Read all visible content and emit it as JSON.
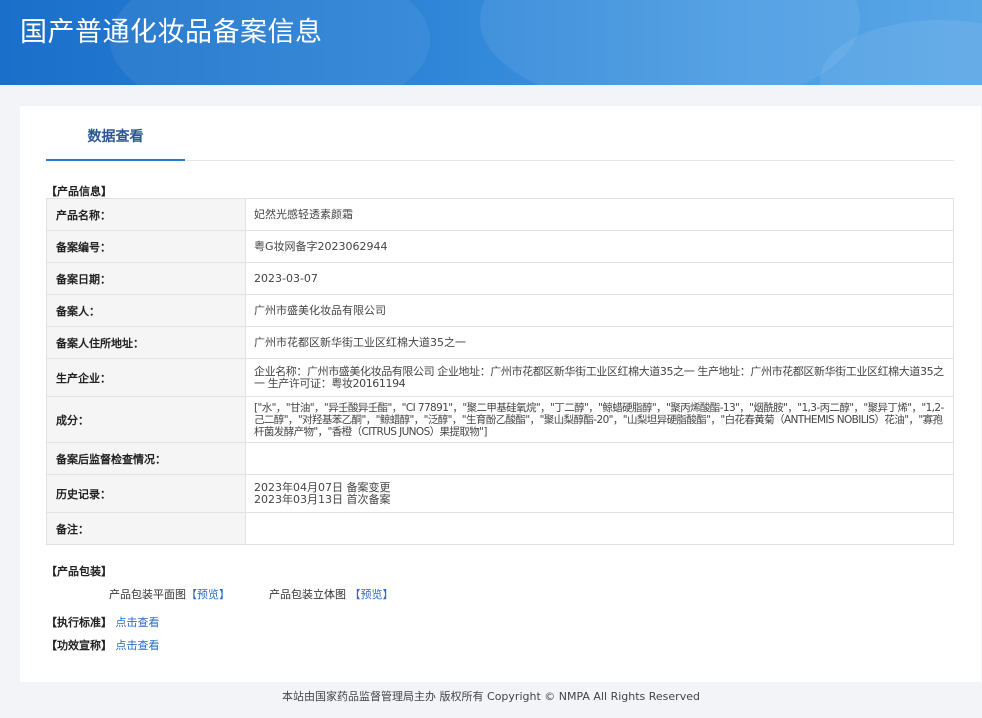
{
  "header": {
    "title": "国产普通化妆品备案信息"
  },
  "tabs": [
    {
      "label": "数据查看"
    }
  ],
  "sections": {
    "product_info": "【产品信息】",
    "packaging": "【产品包装】",
    "standard": "【执行标准】",
    "efficacy": "【功效宣称】"
  },
  "info_rows": [
    {
      "label": "产品名称：",
      "value": "妃然光感轻透素颜霜"
    },
    {
      "label": "备案编号：",
      "value": "粤G妆网备字2023062944"
    },
    {
      "label": "备案日期：",
      "value": "2023-03-07"
    },
    {
      "label": "备案人：",
      "value": "广州市盛美化妆品有限公司"
    },
    {
      "label": "备案人住所地址：",
      "value": "广州市花都区新华街工业区红棉大道35之一"
    },
    {
      "label": "生产企业：",
      "value": "企业名称：广州市盛美化妆品有限公司 企业地址：广州市花都区新华街工业区红棉大道35之一 生产地址：广州市花都区新华街工业区红棉大道35之一 生产许可证：粤妆20161194"
    },
    {
      "label": "成分：",
      "value": "[\"水\"，\"甘油\"，\"异壬酸异壬酯\"，\"CI 77891\"，\"聚二甲基硅氧烷\"，\"丁二醇\"，\"鲸蜡硬脂醇\"，\"聚丙烯酸酯-13\"，\"烟酰胺\"，\"1,3-丙二醇\"，\"聚异丁烯\"，\"1,2-己二醇\"，\"对羟基苯乙酮\"，\"鲸蜡醇\"，\"泛醇\"，\"生育酚乙酸酯\"，\"聚山梨醇酯-20\"，\"山梨坦异硬脂酸酯\"，\"白花春黄菊（ANTHEMIS NOBILIS）花油\"，\"寡孢杆菌发酵产物\"，\"香橙（CITRUS JUNOS）果提取物\"]"
    },
    {
      "label": "备案后监督检查情况：",
      "value": ""
    },
    {
      "label": "历史记录：",
      "value": "2023年04月07日 备案变更",
      "value2": "2023年03月13日 首次备案"
    },
    {
      "label": "备注：",
      "value": ""
    }
  ],
  "packaging": {
    "flat_label": "产品包装平面图",
    "flat_link": "【预览】",
    "stereo_label": "产品包装立体图",
    "stereo_link": "【预览】"
  },
  "standard_link": "点击查看",
  "efficacy_link": "点击查看",
  "footer": "本站由国家药品监督管理局主办 版权所有 Copyright © NMPA All Rights Reserved"
}
